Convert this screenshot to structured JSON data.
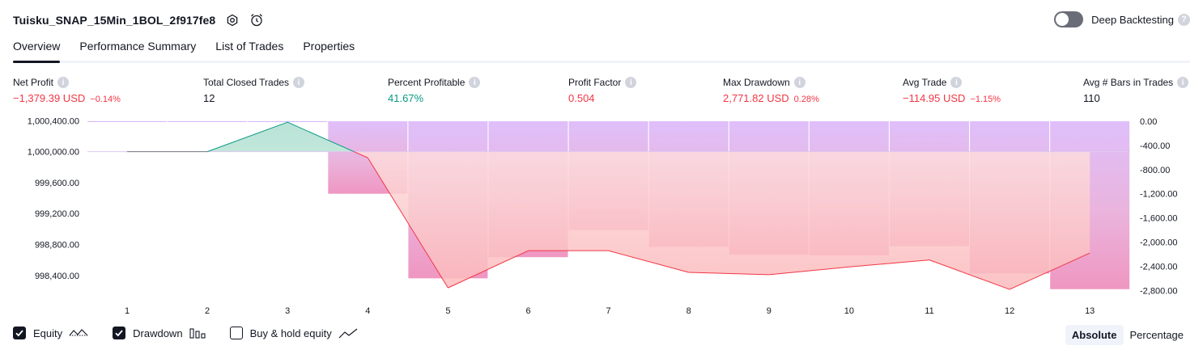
{
  "header": {
    "title": "Tuisku_SNAP_15Min_1BOL_2f917fe8"
  },
  "deep_backtesting": {
    "label": "Deep Backtesting",
    "enabled": false,
    "help": "?"
  },
  "tabs": [
    {
      "label": "Overview",
      "active": true
    },
    {
      "label": "Performance Summary",
      "active": false
    },
    {
      "label": "List of Trades",
      "active": false
    },
    {
      "label": "Properties",
      "active": false
    }
  ],
  "metrics": {
    "net_profit": {
      "label": "Net Profit",
      "value": "−1,379.39 USD",
      "pct": "−0.14%"
    },
    "total_closed_trades": {
      "label": "Total Closed Trades",
      "value": "12"
    },
    "percent_profitable": {
      "label": "Percent Profitable",
      "value": "41.67%"
    },
    "profit_factor": {
      "label": "Profit Factor",
      "value": "0.504"
    },
    "max_drawdown": {
      "label": "Max Drawdown",
      "value": "2,771.82 USD",
      "pct": "0.28%"
    },
    "avg_trade": {
      "label": "Avg Trade",
      "value": "−114.95 USD",
      "pct": "−1.15%"
    },
    "avg_bars": {
      "label": "Avg # Bars in Trades",
      "value": "110"
    },
    "info_glyph": "i"
  },
  "chart_data": {
    "type": "line",
    "x": [
      1,
      2,
      3,
      4,
      5,
      6,
      7,
      8,
      9,
      10,
      11,
      12,
      13
    ],
    "series": [
      {
        "name": "Equity",
        "axis": "left",
        "values": [
          1000000.0,
          1000000.0,
          1000380.0,
          999920.0,
          998240.0,
          998720.0,
          998720.0,
          998440.0,
          998410.0,
          998510.0,
          998600.0,
          998220.0,
          998690.0
        ]
      },
      {
        "name": "Drawdown",
        "axis": "right",
        "type": "bar",
        "values": [
          0,
          0,
          0,
          -1200,
          -2600,
          -2250,
          -1800,
          -2080,
          -2210,
          -2220,
          -2070,
          -2520,
          -2780
        ]
      }
    ],
    "left_axis": {
      "ticks": [
        "1,000,400.00",
        "1,000,000.00",
        "999,600.00",
        "999,200.00",
        "998,800.00",
        "998,400.00"
      ],
      "tick_values": [
        1000400,
        1000000,
        999600,
        999200,
        998800,
        998400
      ]
    },
    "right_axis": {
      "ticks": [
        "0.00",
        "-400.00",
        "-800.00",
        "-1,200.00",
        "-1,600.00",
        "-2,000.00",
        "-2,400.00",
        "-2,800.00"
      ],
      "tick_values": [
        0,
        -400,
        -800,
        -1200,
        -1600,
        -2000,
        -2400,
        -2800
      ]
    },
    "colors": {
      "equity_up": "#089981",
      "equity_down": "#f23645",
      "drawdown_bar": "#d8b6fb",
      "equity_fill_down": "#fdc7c6",
      "equity_fill_up": "#c6e9df"
    }
  },
  "legend": {
    "equity": {
      "label": "Equity",
      "checked": true
    },
    "drawdown": {
      "label": "Drawdown",
      "checked": true
    },
    "buy_hold": {
      "label": "Buy & hold equity",
      "checked": false
    }
  },
  "mode": {
    "absolute": "Absolute",
    "percentage": "Percentage",
    "selected": "Absolute"
  }
}
